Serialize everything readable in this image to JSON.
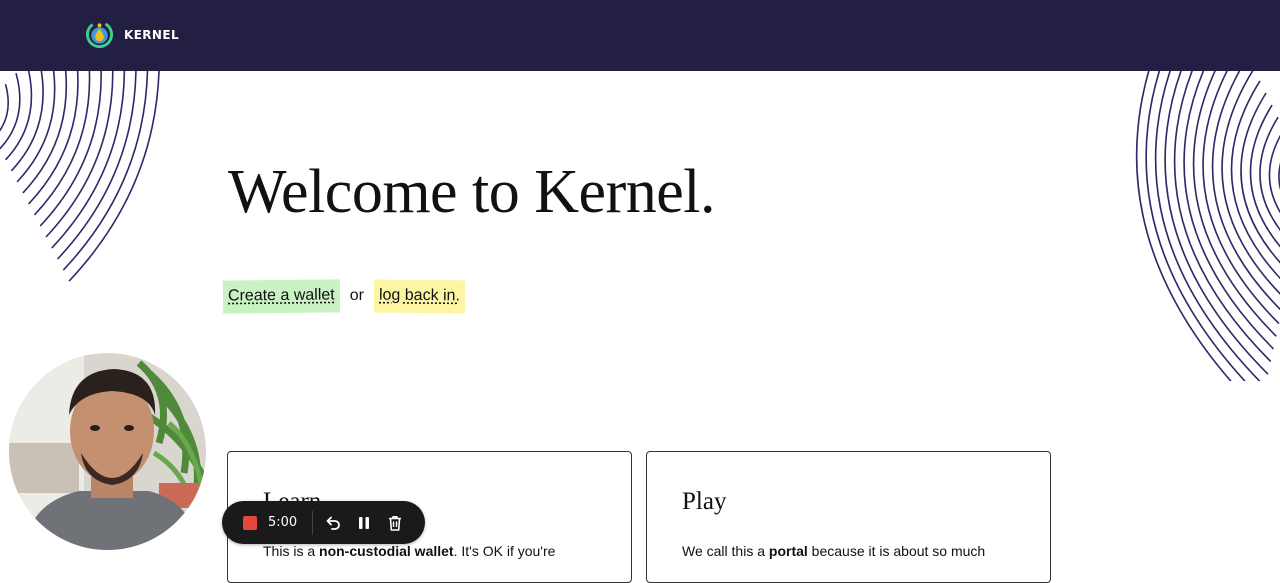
{
  "brand": {
    "name": "KERNEL"
  },
  "hero": {
    "title": "Welcome to Kernel.",
    "create_wallet_label": "Create a wallet",
    "or_text": "or",
    "login_label": "log back in."
  },
  "cards": [
    {
      "title": "Learn",
      "text_before": "This is a ",
      "text_bold": "non-custodial wallet",
      "text_after": ". It's OK if you're"
    },
    {
      "title": "Play",
      "text_before": "We call this a ",
      "text_bold": "portal",
      "text_after": " because it is about so much"
    }
  ],
  "recorder": {
    "time": "5:00",
    "icons": [
      "stop-icon",
      "undo-icon",
      "pause-icon",
      "trash-icon"
    ],
    "stop_color": "#e8463b"
  },
  "colors": {
    "topbar": "#221f43",
    "create_highlight": "#c9f2c3",
    "login_highlight": "#fbf5a4",
    "deco_lines": "#2d2a6a"
  }
}
